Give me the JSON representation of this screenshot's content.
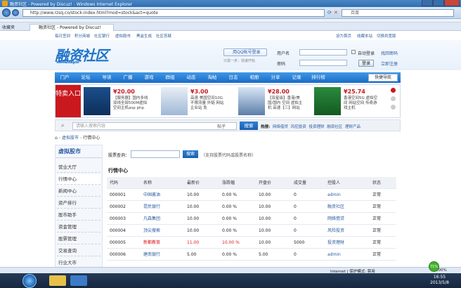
{
  "window": {
    "title": "融资社区 - Powered by Discuz! - Windows Internet Explorer"
  },
  "address": {
    "url": "http://www.rzsq.co/stock-index.html?mod=stock&act=quote"
  },
  "search": {
    "placeholder": "百度"
  },
  "favorites": {
    "label": "收藏夹"
  },
  "tab": {
    "title": "融资社区 - Powered by Discuz!"
  },
  "toplinks": {
    "left": [
      "每日签到",
      "积分商城",
      "社区银行",
      "虚拟股市",
      "黑盒生成",
      "社区答疑"
    ],
    "right": [
      "设为首页",
      "收藏本站",
      "切换到宽版"
    ]
  },
  "header": {
    "logo": "融资社区",
    "logo_sub": "www.rzsq.co",
    "qq_login": "用QQ帐号登录",
    "qq_hint": "只需一步，快速开始",
    "user_label": "用户名",
    "pass_label": "密码",
    "autologin": "自动登录",
    "forgot": "找回密码",
    "register": "立即注册",
    "login_btn": "登录"
  },
  "nav": {
    "items": [
      "门户",
      "论坛",
      "导读",
      "广播",
      "游戏",
      "群组",
      "动态",
      "淘帖",
      "日志",
      "相册",
      "分享",
      "记录",
      "排行榜"
    ],
    "quick": "快捷导航"
  },
  "banner": {
    "hot_label": "特卖入口",
    "ads": [
      {
        "price": "¥20.00",
        "text": "【服务器】国内多线双线全部500M虚拟空间主机asp php"
      },
      {
        "price": "¥3.00",
        "text": "高速 美国空间10G 不限流量 外链 网站 企业站 免"
      },
      {
        "price": "¥28.00",
        "text": "【双星级】香港/美国/国内 空间 虚拟主机 高速【三】网站"
      },
      {
        "price": "¥25.74",
        "text": "香港空间5G 虚拟空间 网站空间 传奇游戏主机"
      }
    ]
  },
  "searchbar": {
    "placeholder": "请输入搜索内容",
    "type": "帖子",
    "button": "搜索",
    "hot_label": "热搜:",
    "hot_words": [
      "网络借贷",
      "风控投资",
      "投资理财",
      "融资社区",
      "理财产品"
    ]
  },
  "breadcrumb": {
    "home": "⌂",
    "items": [
      "虚拟股市",
      "行情中心"
    ]
  },
  "sidebar": {
    "title": "虚拟股市",
    "items": [
      "营业大厅",
      "行情中心",
      "新闻中心",
      "资产排行",
      "股市助手",
      "资金管理",
      "股票管理",
      "交易查询",
      "行业大市"
    ]
  },
  "quote": {
    "query_label": "股票查询：",
    "query_btn": "搜索",
    "query_hint": "（支持股票代码或股票名称）",
    "title": "行情中心",
    "columns": [
      "代码",
      "名称",
      "最新价",
      "涨跌幅",
      "开盘价",
      "成交量",
      "控股人",
      "状态"
    ],
    "rows": [
      {
        "code": "000001",
        "name": "中国酱油",
        "price": "10.00",
        "change": "0.00 %",
        "open": "10.00",
        "volume": "0",
        "holder": "admin",
        "status": "正常",
        "hot": false
      },
      {
        "code": "000002",
        "name": "昆民银行",
        "price": "10.00",
        "change": "0.00 %",
        "open": "10.00",
        "volume": "0",
        "holder": "融资社区",
        "status": "正常",
        "hot": false
      },
      {
        "code": "000003",
        "name": "凡森集团",
        "price": "10.00",
        "change": "0.00 %",
        "open": "10.00",
        "volume": "0",
        "holder": "网络借贷",
        "status": "正常",
        "hot": false
      },
      {
        "code": "000004",
        "name": "顶尖搜索",
        "price": "10.00",
        "change": "0.00 %",
        "open": "10.00",
        "volume": "0",
        "holder": "风险投资",
        "status": "正常",
        "hot": false
      },
      {
        "code": "000005",
        "name": "新都教育",
        "price": "11.00",
        "change": "10.00 %",
        "open": "10.00",
        "volume": "5000",
        "holder": "投资理财",
        "status": "正常",
        "hot": true
      },
      {
        "code": "000006",
        "name": "建南银行",
        "price": "5.00",
        "change": "0.00 %",
        "open": "5.00",
        "volume": "0",
        "holder": "admin",
        "status": "正常",
        "hot": false
      }
    ]
  },
  "statusbar": {
    "zone": "Internet | 保护模式: 禁用",
    "zoom": "100%"
  },
  "taskbar": {
    "time": "16:55",
    "date": "2013/5/8",
    "badge": "71%"
  }
}
